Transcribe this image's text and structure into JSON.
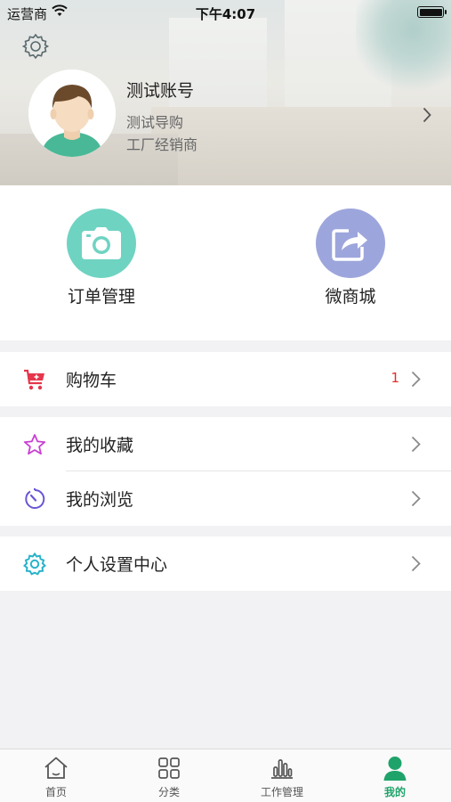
{
  "status_bar": {
    "carrier": "运营商",
    "time": "下午4:07"
  },
  "profile": {
    "name": "测试账号",
    "role": "测试导购",
    "dealer": "工厂经销商"
  },
  "quick_actions": [
    {
      "label": "订单管理",
      "icon": "camera-icon",
      "color": "#6fd3c2"
    },
    {
      "label": "微商城",
      "icon": "share-icon",
      "color": "#9da6dc"
    }
  ],
  "list": {
    "cart": {
      "label": "购物车",
      "count": "1",
      "icon": "cart-icon",
      "color": "#e5364b"
    },
    "favorites": {
      "label": "我的收藏",
      "icon": "star-icon",
      "color": "#c93fd3"
    },
    "history": {
      "label": "我的浏览",
      "icon": "clock-icon",
      "color": "#6b55d6"
    },
    "settings": {
      "label": "个人设置中心",
      "icon": "gear-icon",
      "color": "#28b3c9"
    }
  },
  "tabbar": {
    "items": [
      {
        "label": "首页",
        "icon": "home-icon"
      },
      {
        "label": "分类",
        "icon": "grid-icon"
      },
      {
        "label": "工作管理",
        "icon": "bar-chart-icon"
      },
      {
        "label": "我的",
        "icon": "person-icon"
      }
    ],
    "active_color": "#1fa36a"
  }
}
